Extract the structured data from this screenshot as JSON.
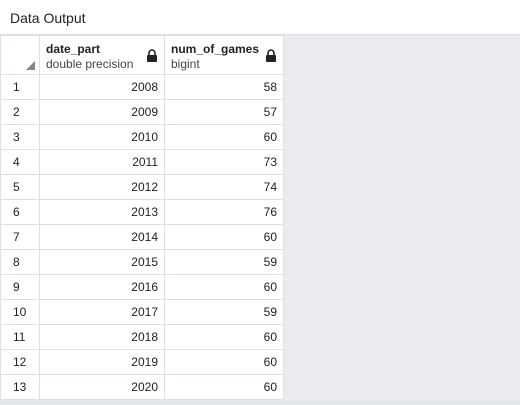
{
  "panel": {
    "title": "Data Output"
  },
  "table": {
    "columns": [
      {
        "name": "date_part",
        "type": "double precision"
      },
      {
        "name": "num_of_games",
        "type": "bigint"
      }
    ],
    "rows": [
      {
        "n": "1",
        "date_part": "2008",
        "num_of_games": "58"
      },
      {
        "n": "2",
        "date_part": "2009",
        "num_of_games": "57"
      },
      {
        "n": "3",
        "date_part": "2010",
        "num_of_games": "60"
      },
      {
        "n": "4",
        "date_part": "2011",
        "num_of_games": "73"
      },
      {
        "n": "5",
        "date_part": "2012",
        "num_of_games": "74"
      },
      {
        "n": "6",
        "date_part": "2013",
        "num_of_games": "76"
      },
      {
        "n": "7",
        "date_part": "2014",
        "num_of_games": "60"
      },
      {
        "n": "8",
        "date_part": "2015",
        "num_of_games": "59"
      },
      {
        "n": "9",
        "date_part": "2016",
        "num_of_games": "60"
      },
      {
        "n": "10",
        "date_part": "2017",
        "num_of_games": "59"
      },
      {
        "n": "11",
        "date_part": "2018",
        "num_of_games": "60"
      },
      {
        "n": "12",
        "date_part": "2019",
        "num_of_games": "60"
      },
      {
        "n": "13",
        "date_part": "2020",
        "num_of_games": "60"
      }
    ]
  },
  "icons": {
    "column_lock": "lock-icon",
    "select_all": "select-all-corner-icon"
  },
  "colors": {
    "grid_border": "#dde0e6",
    "panel_background": "#e9ebee"
  }
}
